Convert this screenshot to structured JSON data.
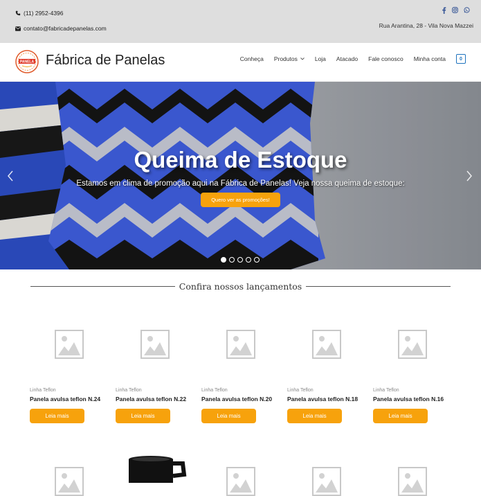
{
  "topbar": {
    "phone": "(11) 2952-4396",
    "email": "contato@fabricadepanelas.com",
    "address": "Rua Arantina, 28 - Vila Nova Mazzei",
    "social": [
      "facebook-icon",
      "instagram-icon",
      "whatsapp-icon"
    ]
  },
  "header": {
    "brand": "Fábrica de Panelas",
    "logo_text": "PANELA",
    "nav": {
      "conheca": "Conheça",
      "produtos": "Produtos",
      "loja": "Loja",
      "atacado": "Atacado",
      "fale": "Fale conosco",
      "conta": "Minha conta"
    },
    "cart_count": "0"
  },
  "hero": {
    "title": "Queima de Estoque",
    "subtitle": "Estamos em clima de promoção aqui na Fábrica de Panelas! Veja nossa queima de estoque:",
    "button": "Quero ver as promoções!",
    "slide_count": 5,
    "active_slide": 1
  },
  "section": {
    "title": "Confira nossos lançamentos"
  },
  "products": [
    {
      "category": "Linha Teflon",
      "name": "Panela avulsa teflon N.24",
      "button": "Leia mais"
    },
    {
      "category": "Linha Teflon",
      "name": "Panela avulsa teflon N.22",
      "button": "Leia mais"
    },
    {
      "category": "Linha Teflon",
      "name": "Panela avulsa teflon N.20",
      "button": "Leia mais"
    },
    {
      "category": "Linha Teflon",
      "name": "Panela avulsa teflon N.18",
      "button": "Leia mais"
    },
    {
      "category": "Linha Teflon",
      "name": "Panela avulsa teflon N.16",
      "button": "Leia mais"
    }
  ],
  "colors": {
    "accent": "#f7a20c",
    "brand_blue": "#1e73be",
    "topbar_bg": "#dedede"
  }
}
